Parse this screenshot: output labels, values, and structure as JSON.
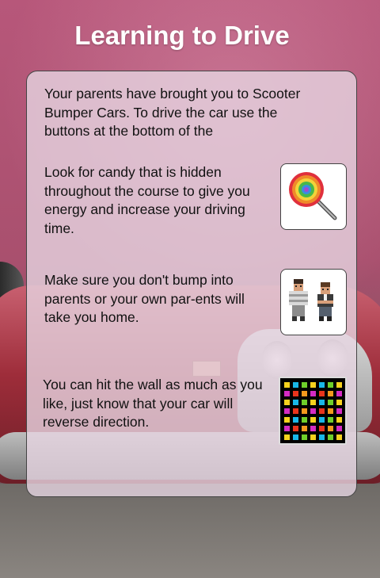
{
  "title": "Learning to Drive",
  "paragraphs": {
    "intro": "Your parents have brought you to Scooter Bumper Cars. To drive the car use the buttons at the bottom of the",
    "candy": "Look for candy that is hidden throughout the course to give you energy and increase your driving time.",
    "parents": "Make sure you don't bump into parents or your own par-ents will take you home.",
    "wall": "You can hit the wall as much as you like, just know that your car will reverse direction."
  },
  "icons": {
    "candy": "lollipop-icon",
    "parents": "parents-icon",
    "wall": "wall-grid-icon"
  },
  "colors": {
    "title": "#ffffff",
    "panel_fill": "#e6d4e1",
    "text": "#111111"
  }
}
